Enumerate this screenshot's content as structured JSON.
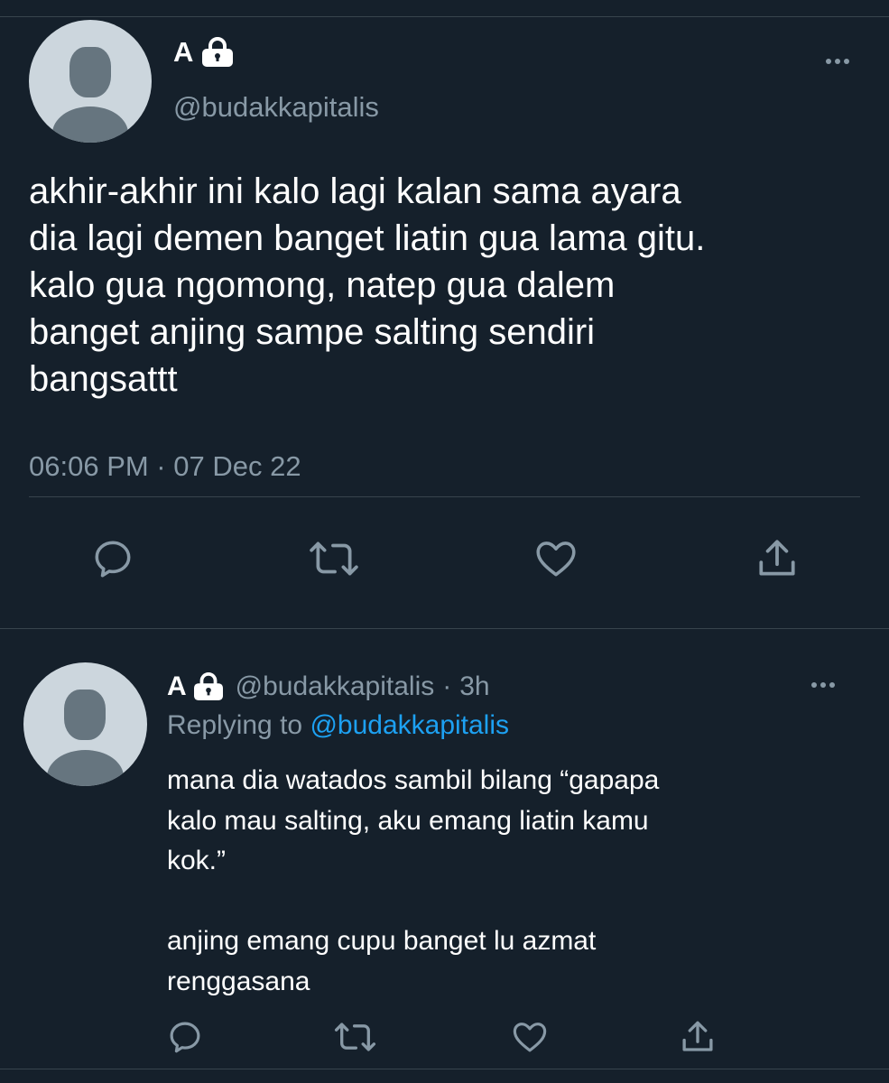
{
  "main_tweet": {
    "display_name": "A",
    "handle": "@budakkapitalis",
    "text_lines": [
      "akhir-akhir ini kalo lagi kalan sama ayara",
      "dia lagi demen banget liatin gua lama gitu.",
      "kalo gua ngomong, natep gua dalem",
      "banget anjing sampe salting sendiri",
      "bangsattt"
    ],
    "timestamp": "06:06 PM · 07 Dec 22",
    "actions": [
      "reply-icon",
      "retweet-icon",
      "like-icon",
      "share-icon"
    ]
  },
  "reply_tweet": {
    "display_name": "A",
    "handle": "@budakkapitalis",
    "separator": "·",
    "time": "3h",
    "replying_prefix": "Replying to",
    "replying_to": "@budakkapitalis",
    "text_lines": [
      "mana dia watados sambil bilang “gapapa",
      "kalo mau salting, aku emang liatin kamu",
      "kok.”",
      "",
      "anjing emang cupu banget lu azmat",
      "renggasana"
    ],
    "actions": [
      "reply-icon",
      "retweet-icon",
      "like-icon",
      "share-icon"
    ]
  },
  "colors": {
    "background": "#15202b",
    "divider": "#38444d",
    "secondary_text": "#8899a6",
    "link": "#1da1f2",
    "avatar_bg": "#ccd6dd",
    "avatar_fg": "#66757f"
  }
}
